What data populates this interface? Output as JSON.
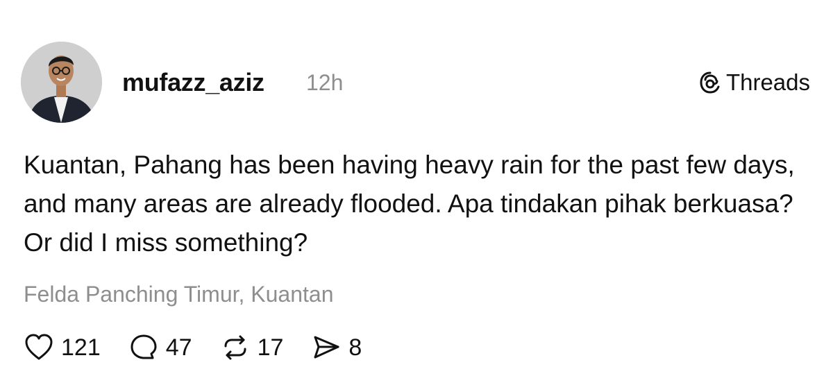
{
  "post": {
    "author": {
      "username": "mufazz_aziz",
      "avatar_icon": "profile-photo"
    },
    "time_ago": "12h",
    "brand": {
      "label": "Threads",
      "icon": "threads-logo-icon"
    },
    "text": "Kuantan, Pahang has been having heavy rain for the past few days, and many areas are already flooded. Apa tindakan pihak berkuasa? Or did I miss something?",
    "location": "Felda Panching Timur, Kuantan",
    "actions": {
      "likes": "121",
      "replies": "47",
      "reposts": "17",
      "shares": "8"
    }
  },
  "colors": {
    "text": "#111111",
    "muted": "#8e8e8e",
    "background": "#ffffff"
  }
}
